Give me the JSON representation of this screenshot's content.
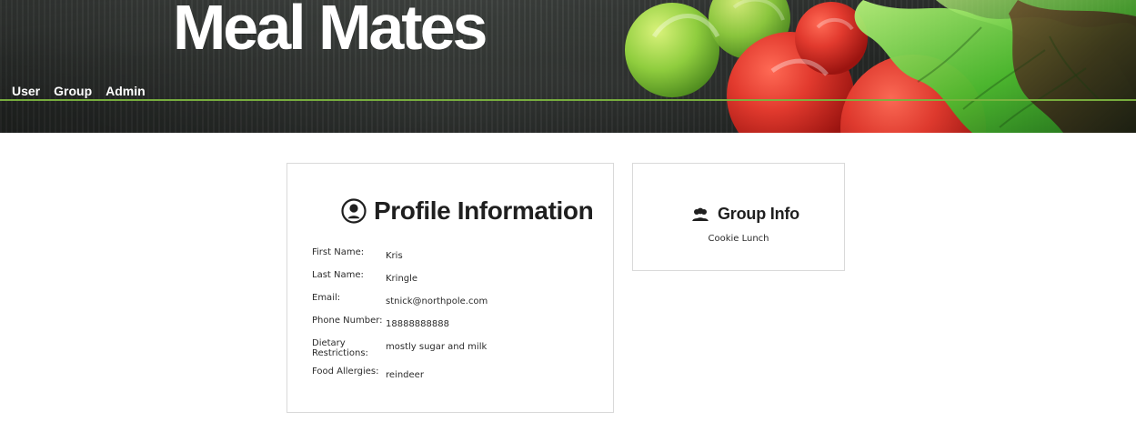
{
  "header": {
    "brand_title": "Meal Mates",
    "nav": [
      {
        "label": "User"
      },
      {
        "label": "Group"
      },
      {
        "label": "Admin"
      }
    ],
    "accent_color": "#7bb33f"
  },
  "profile": {
    "title": "Profile Information",
    "icon": "user-circle-icon",
    "fields": [
      {
        "label": "First Name:",
        "value": "Kris"
      },
      {
        "label": "Last Name:",
        "value": "Kringle"
      },
      {
        "label": "Email:",
        "value": "stnick@northpole.com"
      },
      {
        "label": "Phone Number:",
        "value": "18888888888"
      },
      {
        "label": "Dietary Restrictions:",
        "value": "mostly sugar and milk"
      },
      {
        "label": "Food Allergies:",
        "value": "reindeer"
      }
    ]
  },
  "group": {
    "title": "Group Info",
    "icon": "users-icon",
    "name": "Cookie Lunch"
  }
}
